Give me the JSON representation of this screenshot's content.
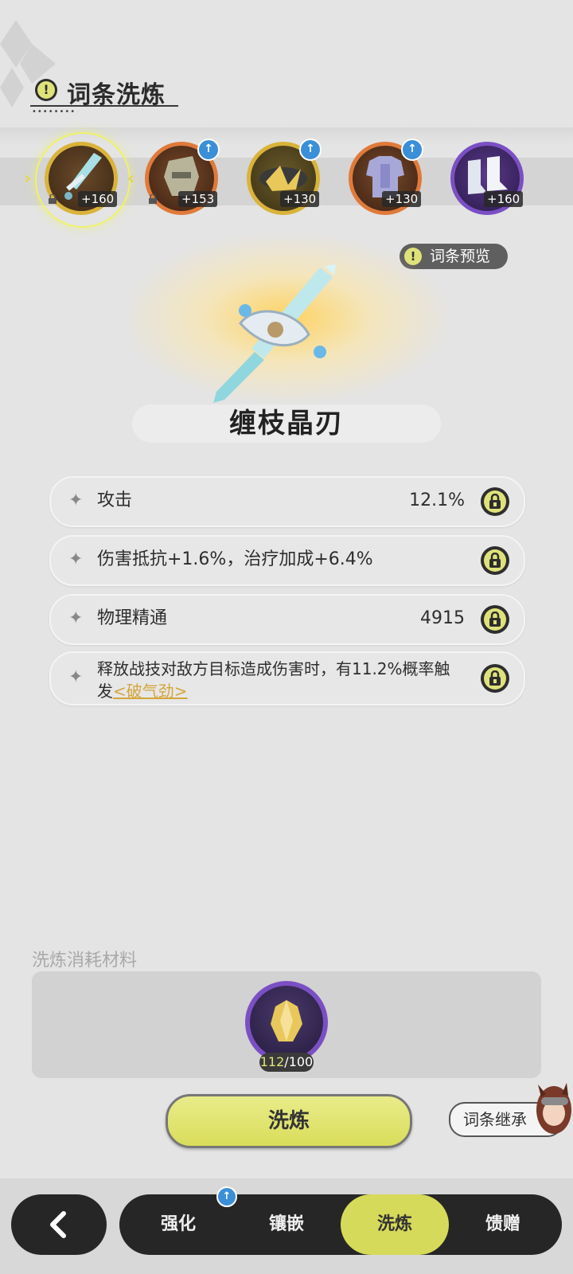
{
  "header": {
    "title": "词条洗炼",
    "info_icon": "exclamation-icon"
  },
  "equipment": [
    {
      "name": "sword",
      "level": "+160",
      "locked": true,
      "selected": true,
      "upgrade": false,
      "ring_color": "#d9b33a"
    },
    {
      "name": "helmet",
      "level": "+153",
      "locked": true,
      "selected": false,
      "upgrade": true,
      "ring_color": "#e07a3a"
    },
    {
      "name": "gauntlet",
      "level": "+130",
      "locked": false,
      "selected": false,
      "upgrade": true,
      "ring_color": "#d9b33a"
    },
    {
      "name": "armor",
      "level": "+130",
      "locked": false,
      "selected": false,
      "upgrade": true,
      "ring_color": "#e07a3a"
    },
    {
      "name": "boots",
      "level": "+160",
      "locked": false,
      "selected": false,
      "upgrade": false,
      "ring_color": "#7b4fc4"
    }
  ],
  "preview_button": "词条预览",
  "item": {
    "name": "缠枝晶刃"
  },
  "stats": [
    {
      "label": "攻击",
      "value": "12.1%"
    },
    {
      "label": "伤害抵抗+1.6%，治疗加成+6.4%",
      "value": ""
    },
    {
      "label": "物理精通",
      "value": "4915"
    },
    {
      "label_prefix": "释放战技对敌方目标造成伤害时，有11.2%概率触发",
      "link": "<破气劲>",
      "value": ""
    }
  ],
  "materials": {
    "title": "洗炼消耗材料",
    "have": "112",
    "need": "/100"
  },
  "actions": {
    "refine": "洗炼",
    "inherit": "词条继承"
  },
  "nav": {
    "back_icon": "chevron-left-icon",
    "tabs": [
      "强化",
      "镶嵌",
      "洗炼",
      "馈赠"
    ],
    "active_tab": "洗炼"
  },
  "colors": {
    "accent": "#d6da5a",
    "dark": "#262626",
    "link": "#d4a63a",
    "badge_blue": "#3a8fd8"
  }
}
